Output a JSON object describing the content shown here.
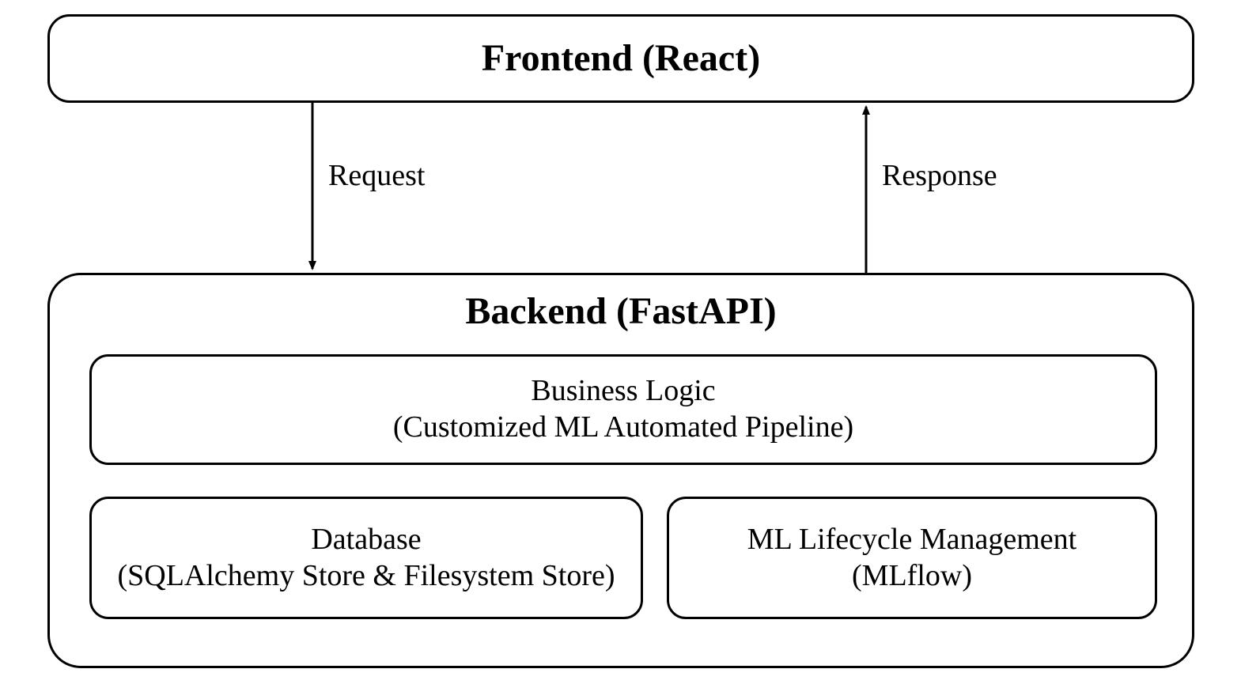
{
  "frontend": {
    "title": "Frontend (React)"
  },
  "backend": {
    "title": "Backend (FastAPI)"
  },
  "business_logic": {
    "line1": "Business Logic",
    "line2": "(Customized ML Automated Pipeline)"
  },
  "database": {
    "line1": "Database",
    "line2": "(SQLAlchemy Store & Filesystem Store)"
  },
  "ml_lifecycle": {
    "line1": "ML Lifecycle Management",
    "line2": "(MLflow)"
  },
  "edges": {
    "request": "Request",
    "response": "Response"
  }
}
